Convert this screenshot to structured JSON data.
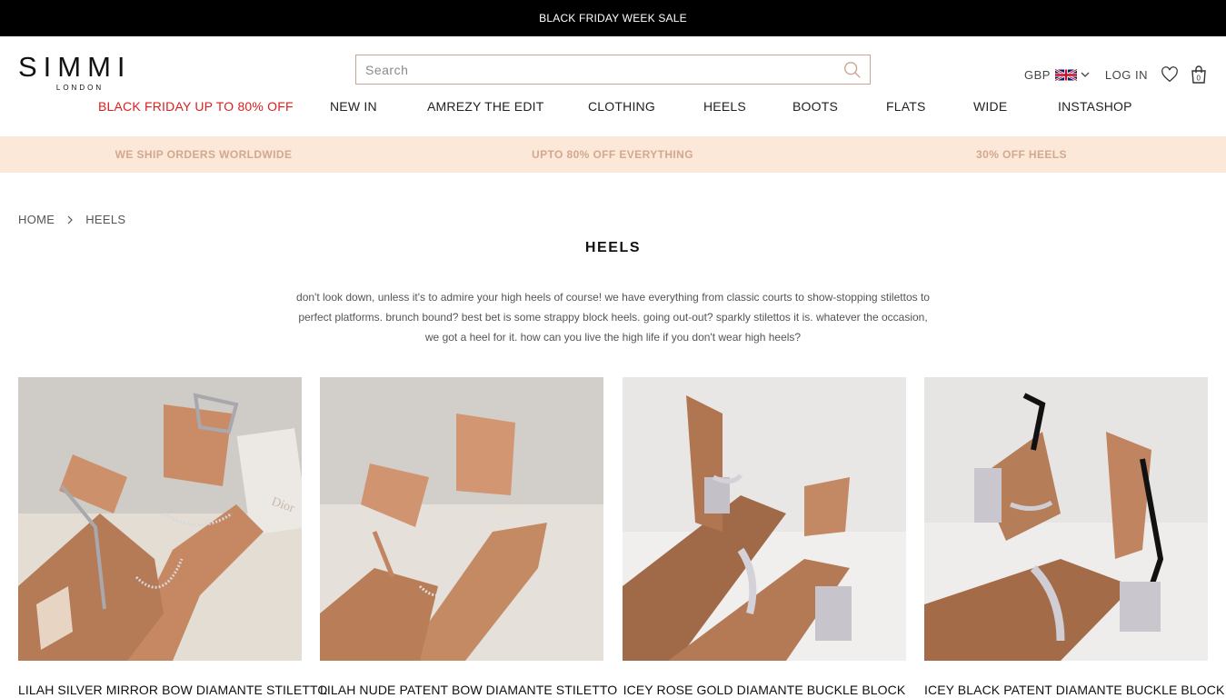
{
  "topbar": {
    "text": "BLACK FRIDAY WEEK SALE"
  },
  "logo": {
    "main": "SIMMI",
    "sub": "LONDON"
  },
  "search": {
    "placeholder": "Search"
  },
  "util": {
    "currency": "GBP",
    "login": "LOG IN",
    "cart_count": "0"
  },
  "nav": {
    "items": [
      "BLACK FRIDAY UP TO 80% OFF",
      "NEW IN",
      "AMREZY THE EDIT",
      "CLOTHING",
      "HEELS",
      "BOOTS",
      "FLATS",
      "WIDE",
      "INSTASHOP"
    ]
  },
  "promo": {
    "items": [
      "WE SHIP ORDERS WORLDWIDE",
      "UPTO 80% OFF EVERYTHING",
      "30% OFF HEELS"
    ]
  },
  "breadcrumb": {
    "home": "HOME",
    "current": "HEELS"
  },
  "page": {
    "title": "HEELS",
    "description_lines": [
      "don't look down, unless it's to admire your high heels of course! we have everything from classic courts to show-stopping stilettos to",
      "perfect platforms. brunch bound? best bet is some strappy block heels. going out-out? sparkly stilettos it is. whatever the occasion,",
      "we got a heel for it. how can you live the high life if you don't wear high heels?"
    ]
  },
  "products": [
    {
      "name": "LILAH SILVER MIRROR BOW DIAMANTE STILETTO"
    },
    {
      "name": "LILAH NUDE PATENT BOW DIAMANTE STILETTO"
    },
    {
      "name": "ICEY ROSE GOLD DIAMANTE BUCKLE BLOCK"
    },
    {
      "name": "ICEY BLACK PATENT DIAMANTE BUCKLE BLOCK"
    }
  ],
  "colors": {
    "sale": "#d9201f",
    "promo_bg": "#fbe8d8",
    "promo_text": "#d3a88f",
    "search_border": "#c9a491"
  }
}
